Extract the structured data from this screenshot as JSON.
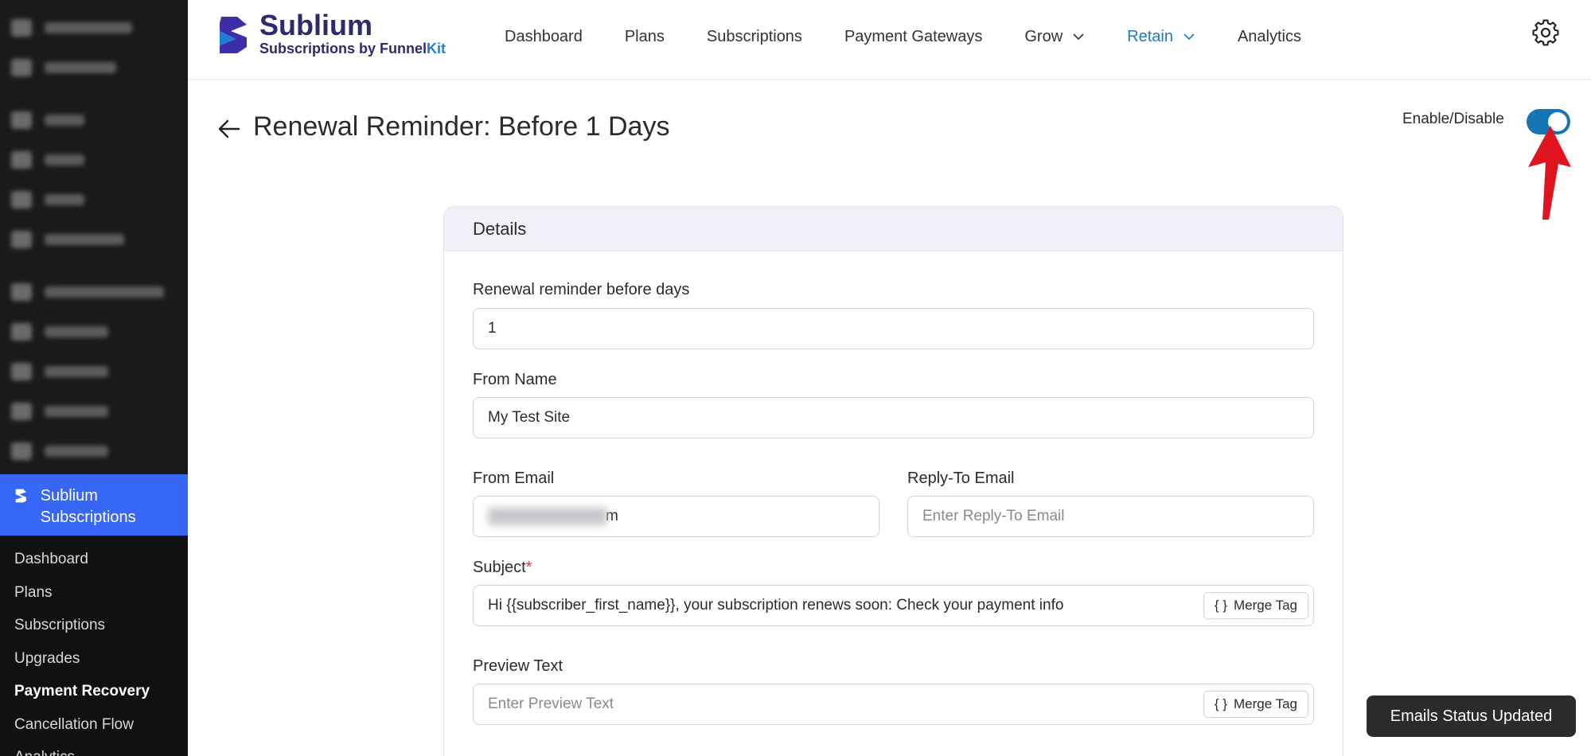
{
  "sidebar": {
    "plugin_label": "Sublium Subscriptions",
    "items": [
      {
        "label": "Dashboard",
        "active": false
      },
      {
        "label": "Plans",
        "active": false
      },
      {
        "label": "Subscriptions",
        "active": false
      },
      {
        "label": "Upgrades",
        "active": false
      },
      {
        "label": "Payment Recovery",
        "active": true
      },
      {
        "label": "Cancellation Flow",
        "active": false
      },
      {
        "label": "Analytics",
        "active": false
      }
    ]
  },
  "header": {
    "brand_name": "Sublium",
    "brand_tagline_prefix": "Subscriptions by ",
    "brand_tagline_funnel": "Funnel",
    "brand_tagline_kit": "Kit",
    "nav": {
      "dashboard": "Dashboard",
      "plans": "Plans",
      "subscriptions": "Subscriptions",
      "payment_gateways": "Payment Gateways",
      "grow": "Grow",
      "retain": "Retain",
      "analytics": "Analytics"
    },
    "active_nav": "Retain",
    "settings_icon": "gear-icon"
  },
  "page": {
    "title": "Renewal Reminder: Before 1 Days",
    "toggle_label": "Enable/Disable",
    "toggle_on": true,
    "accent_color": "#1576b6",
    "annotation_color": "#e0141e"
  },
  "card": {
    "title": "Details",
    "fields": {
      "renewal_days": {
        "label": "Renewal reminder before days",
        "value": "1"
      },
      "from_name": {
        "label": "From Name",
        "value": "My Test Site"
      },
      "from_email": {
        "label": "From Email",
        "value_visible_suffix": "m"
      },
      "reply_to": {
        "label": "Reply-To Email",
        "placeholder": "Enter Reply-To Email"
      },
      "subject": {
        "label": "Subject",
        "required_mark": "*",
        "value": "Hi {{subscriber_first_name}}, your subscription renews soon: Check your payment info"
      },
      "preview_text": {
        "label": "Preview Text",
        "placeholder": "Enter Preview Text"
      }
    },
    "merge_tag_label": "Merge Tag",
    "merge_tag_icon": "{ }"
  },
  "toast": {
    "message": "Emails Status Updated"
  }
}
